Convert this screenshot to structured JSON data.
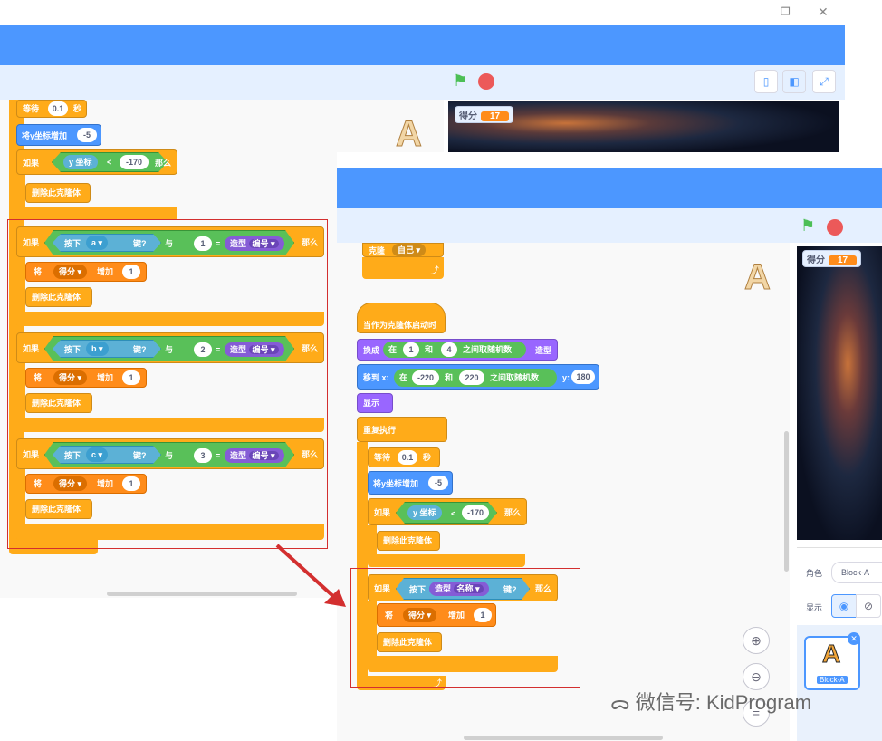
{
  "window": {
    "min_icon": "minimize-icon",
    "max_icon": "restore-icon",
    "close_icon": "close-icon"
  },
  "colors": {
    "menu_blue": "#4c97ff",
    "control": "#ffab19",
    "variables": "#ff8c1a",
    "motion": "#4c97ff",
    "looks": "#9966ff",
    "operators": "#59c059",
    "sensing": "#5cb1d6",
    "highlight": "#d32f2f"
  },
  "back": {
    "score_label": "得分",
    "score_value": "17",
    "blocks": {
      "wait": "等待",
      "wait_val": "0.1",
      "wait_unit": "秒",
      "change_y": "将y坐标增加",
      "change_y_val": "-5",
      "if": "如果",
      "y_pos": "y 坐标",
      "lt": "<",
      "y_val": "-170",
      "then": "那么",
      "delete_clone": "删除此克隆体",
      "key_pressed": "按下",
      "key_suffix": "键?",
      "and": "与",
      "eq": "=",
      "costume": "造型",
      "costume_num": "编号 ▾",
      "set_change": "将",
      "var_score": "得分 ▾",
      "change_by": "增加",
      "one": "1",
      "rules": [
        {
          "key": "a ▾",
          "num": "1"
        },
        {
          "key": "b ▾",
          "num": "2"
        },
        {
          "key": "c ▾",
          "num": "3"
        }
      ]
    }
  },
  "front": {
    "score_label": "得分",
    "score_value": "17",
    "clone_self": "克隆",
    "clone_target": "自己 ▾",
    "when_clone": "当作为克隆体启动时",
    "switch_costume": "换成",
    "in": "在",
    "and_word": "和",
    "rand1": "1",
    "rand4": "4",
    "rand_suffix": "之间取随机数",
    "costume_word": "造型",
    "goto": "移到 x:",
    "x_from": "-220",
    "x_to": "220",
    "y_label": "y:",
    "y_val": "180",
    "show": "显示",
    "forever": "重复执行",
    "wait": "等待",
    "wait_val": "0.1",
    "wait_unit": "秒",
    "change_y": "将y坐标增加",
    "change_y_val": "-5",
    "if": "如果",
    "y_pos": "y 坐标",
    "lt": "<",
    "y_cmp": "-170",
    "then": "那么",
    "delete_clone": "删除此克隆体",
    "key_pressed": "按下",
    "costume": "造型",
    "costume_name": "名称 ▾",
    "key_suffix": "键?",
    "set_change": "将",
    "var_score": "得分 ▾",
    "change_by": "增加",
    "one": "1",
    "sprite_label": "角色",
    "sprite_name": "Block-A",
    "show_label": "显示",
    "sprite_thumb_label": "Block-A",
    "zoom_in_icon": "zoom-in-icon",
    "zoom_out_icon": "zoom-out-icon",
    "zoom_reset_icon": "zoom-reset-icon"
  },
  "watermark": "微信号: KidProgram"
}
